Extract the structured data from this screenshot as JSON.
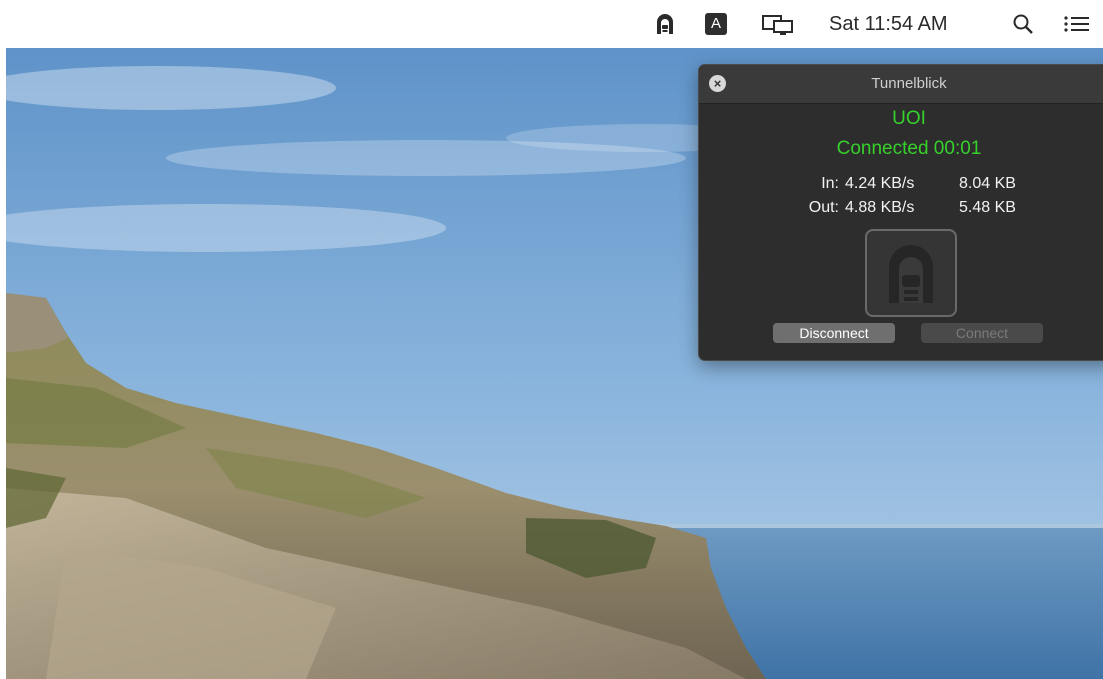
{
  "menubar": {
    "icons": [
      "tunnelblick-icon",
      "input-source-icon",
      "display-mirroring-icon",
      "search-icon",
      "notification-center-icon"
    ],
    "input_source_label": "A",
    "clock": "Sat 11:54 AM"
  },
  "tunnelblick_window": {
    "title": "Tunnelblick",
    "connection_name": "UOI",
    "status": "Connected 00:01",
    "status_color": "#36d12b",
    "in": {
      "label": "In:",
      "rate": "4.24 KB/s",
      "total": "8.04 KB"
    },
    "out": {
      "label": "Out:",
      "rate": "4.88 KB/s",
      "total": "5.48 KB"
    },
    "buttons": {
      "disconnect": "Disconnect",
      "connect": "Connect"
    }
  }
}
